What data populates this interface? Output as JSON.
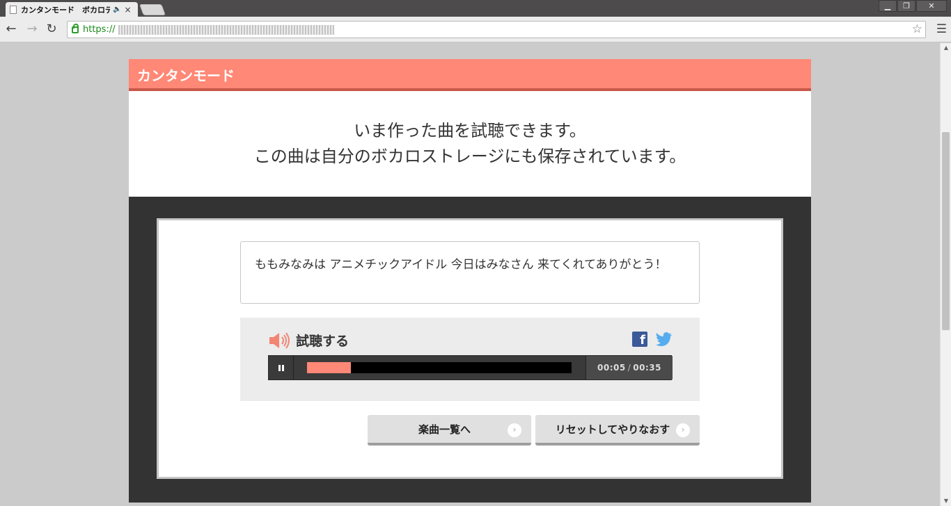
{
  "browser": {
    "tab_title": "カンタンモード　ボカロデュ",
    "tab_audio_glyph": "🔈",
    "tab_close_glyph": "×",
    "url_scheme": "https://",
    "win_minimize": "▁",
    "win_restore": "❐",
    "win_close": "✕",
    "back_glyph": "←",
    "forward_glyph": "→",
    "reload_glyph": "↻",
    "star_glyph": "☆",
    "menu_glyph": "☰"
  },
  "header": {
    "title": "カンタンモード"
  },
  "intro": {
    "line1": "いま作った曲を試聴できます。",
    "line2": "この曲は自分のボカロストレージにも保存されています。"
  },
  "lyrics": {
    "text": "ももみなみは アニメチックアイドル 今日はみなさん 来てくれてありがとう！"
  },
  "player": {
    "label": "試聴する",
    "current_time": "00:05",
    "separator": "/",
    "total_time": "00:35",
    "progress": 0.1667,
    "fb_glyph": "f"
  },
  "buttons": {
    "list_label": "楽曲一覧へ",
    "reset_label": "リセットしてやりなおす",
    "chevron": "›"
  },
  "colors": {
    "accent": "#ff8876",
    "accent_dark": "#c7584a",
    "dark_bg": "#333333"
  }
}
